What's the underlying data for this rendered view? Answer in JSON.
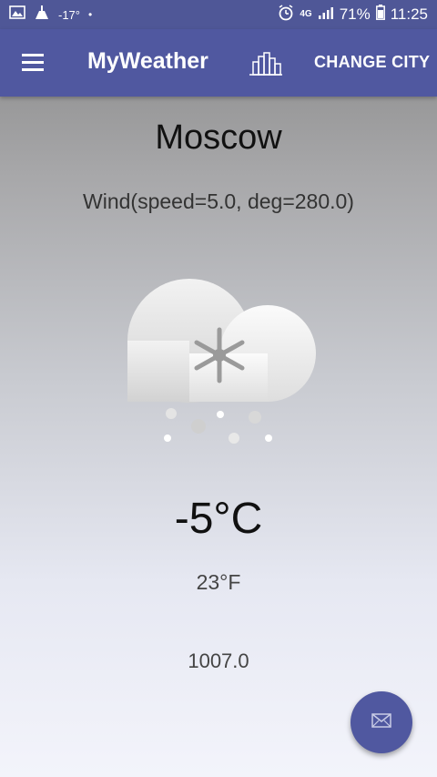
{
  "status_bar": {
    "temperature": "-17°",
    "dot": "•",
    "network": "4G",
    "battery": "71%",
    "time": "11:25",
    "icons": [
      "image-icon",
      "cleaning-icon",
      "alarm-icon",
      "signal-icon",
      "battery-icon"
    ]
  },
  "toolbar": {
    "title": "MyWeather",
    "change_city_label": "CHANGE CITY",
    "icons": [
      "menu-icon",
      "city-chart-icon"
    ]
  },
  "main": {
    "city": "Moscow",
    "wind": "Wind(speed=5.0, deg=280.0)",
    "weather_icon": "snow-cloud-icon",
    "temp_c": "-5°C",
    "temp_f": "23°F",
    "pressure": "1007.0"
  },
  "fab": {
    "icon": "mail-icon"
  },
  "colors": {
    "primary": "#5058a0",
    "status_bar": "#4f5797",
    "text_dark": "#111111"
  }
}
